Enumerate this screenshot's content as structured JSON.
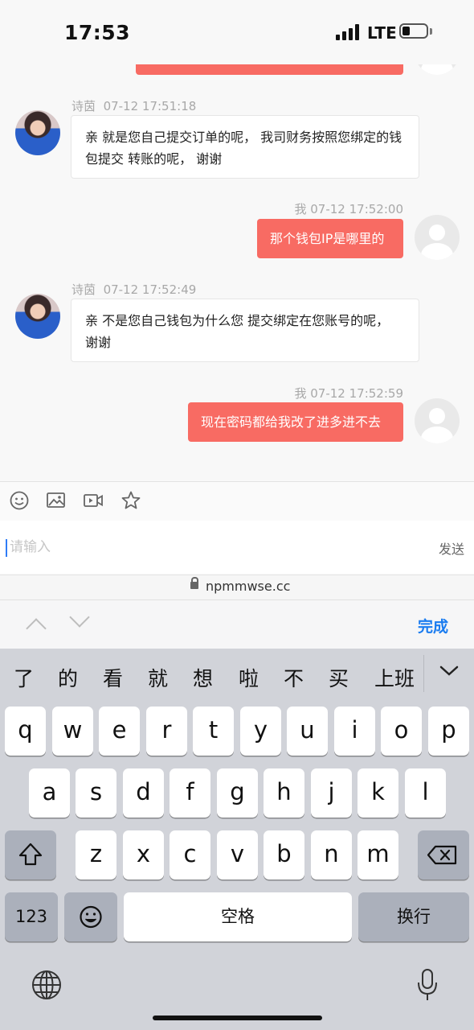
{
  "status_bar": {
    "time": "17:53",
    "network": "LTE",
    "icons": [
      "signal-icon",
      "battery-icon"
    ]
  },
  "chat": {
    "messages": [
      {
        "sender": "me",
        "text": ""
      },
      {
        "sender": "agent",
        "name": "诗茵",
        "time": "07-12 17:51:18",
        "text": "亲  就是您自己提交订单的呢， 我司财务按照您绑定的钱包提交 转账的呢， 谢谢"
      },
      {
        "sender": "me",
        "name": "我",
        "time": "07-12 17:52:00",
        "text": "那个钱包IP是哪里的"
      },
      {
        "sender": "agent",
        "name": "诗茵",
        "time": "07-12 17:52:49",
        "text": "亲  不是您自己钱包为什么您 提交绑定在您账号的呢， 谢谢"
      },
      {
        "sender": "me",
        "name": "我",
        "time": "07-12 17:52:59",
        "text": "现在密码都给我改了进多进不去"
      }
    ]
  },
  "toolbar": {
    "icons": [
      "emoji-icon",
      "image-icon",
      "video-icon",
      "star-icon"
    ]
  },
  "composer": {
    "placeholder": "请输入",
    "value": "",
    "send_label": "发送"
  },
  "browser": {
    "url": "npmmwse.cc"
  },
  "accessory": {
    "done_label": "完成"
  },
  "keyboard": {
    "candidates": [
      "了",
      "的",
      "看",
      "就",
      "想",
      "啦",
      "不",
      "买",
      "上班"
    ],
    "row1": [
      "q",
      "w",
      "e",
      "r",
      "t",
      "y",
      "u",
      "i",
      "o",
      "p"
    ],
    "row2": [
      "a",
      "s",
      "d",
      "f",
      "g",
      "h",
      "j",
      "k",
      "l"
    ],
    "row3": [
      "z",
      "x",
      "c",
      "v",
      "b",
      "n",
      "m"
    ],
    "num_label": "123",
    "space_label": "空格",
    "return_label": "换行"
  },
  "colors": {
    "outgoing_bubble": "#f86b63",
    "accent": "#1a7cf0",
    "keyboard_bg": "#d1d3d9"
  }
}
